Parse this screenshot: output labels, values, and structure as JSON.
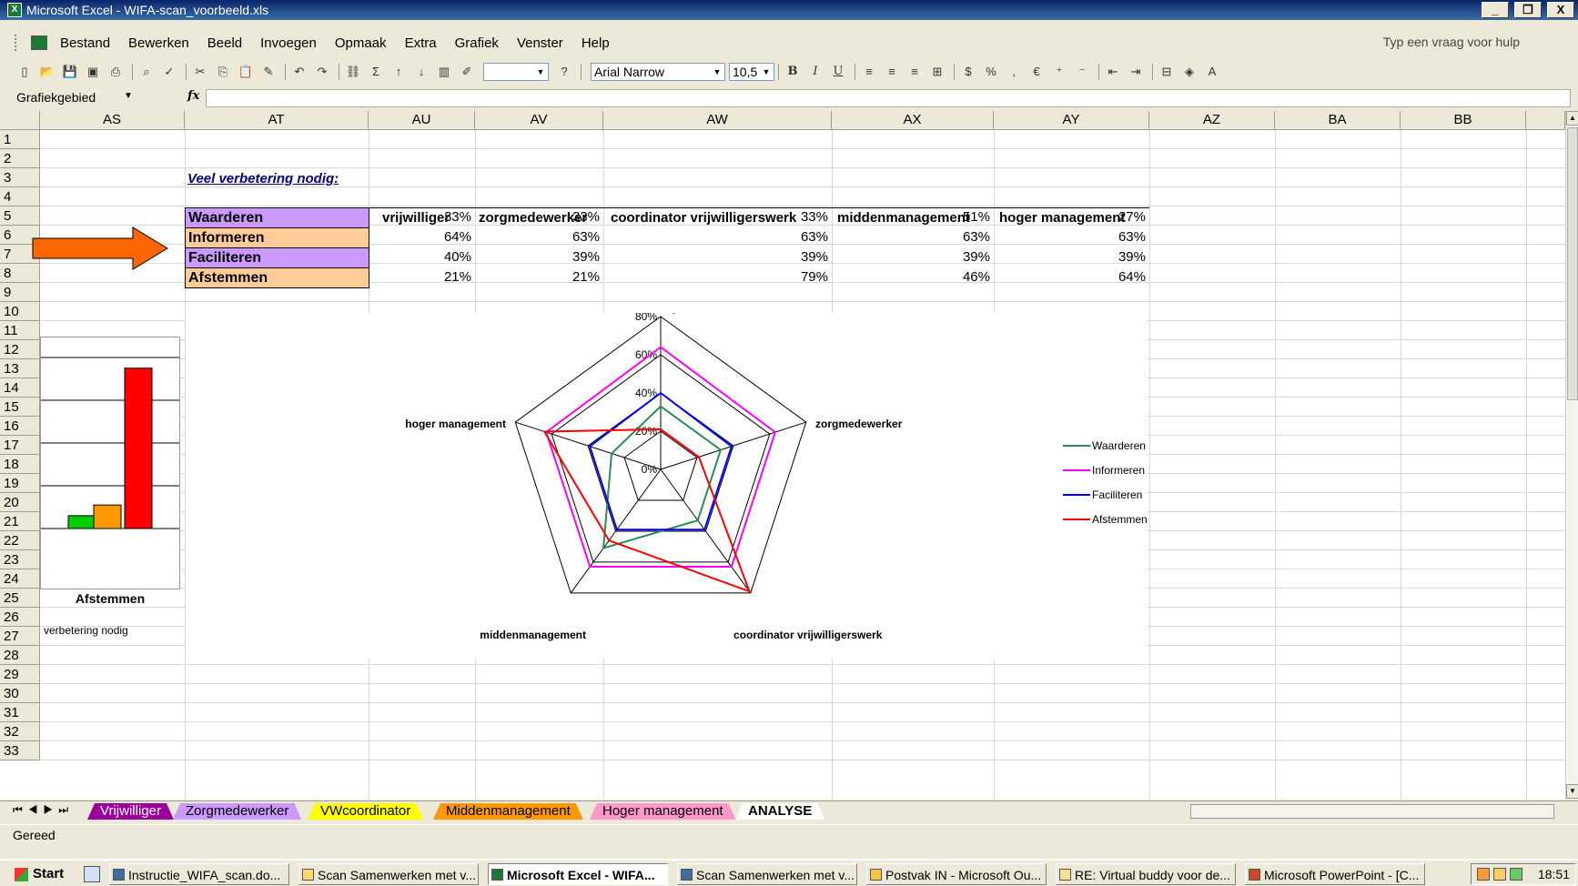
{
  "window": {
    "title": "Microsoft Excel - WIFA-scan_voorbeeld.xls",
    "min_label": "_",
    "restore_label": "❐",
    "close_label": "X"
  },
  "menu": {
    "items": [
      "Bestand",
      "Bewerken",
      "Beeld",
      "Invoegen",
      "Opmaak",
      "Extra",
      "Grafiek",
      "Venster",
      "Help"
    ],
    "help_placeholder": "Typ een vraag voor hulp"
  },
  "toolbar": {
    "font_name": "Arial Narrow",
    "font_size": "10,5",
    "bold_label": "B",
    "italic_label": "I",
    "underline_label": "U"
  },
  "formula_bar": {
    "name_box": "Grafiekgebied",
    "fx_label": "fx",
    "value": ""
  },
  "columns": [
    "AS",
    "AT",
    "AU",
    "AV",
    "AW",
    "AX",
    "AY",
    "AZ",
    "BA",
    "BB"
  ],
  "rows": [
    "1",
    "2",
    "3",
    "4",
    "5",
    "6",
    "7",
    "8",
    "9",
    "10",
    "11",
    "12",
    "13",
    "14",
    "15",
    "16",
    "17",
    "18",
    "19",
    "20",
    "21",
    "22",
    "23",
    "24",
    "25",
    "26",
    "27",
    "28",
    "29",
    "30",
    "31",
    "32",
    "33"
  ],
  "sheet": {
    "section_title": "Veel verbetering nodig:",
    "table_headers": [
      "vrijwilliger",
      "zorgmedewerker",
      "coordinator vrijwilligerswerk",
      "middenmanagement",
      "hoger management"
    ],
    "table_rows": [
      {
        "label": "Waarderen",
        "values": [
          "33%",
          "33%",
          "33%",
          "51%",
          "27%"
        ]
      },
      {
        "label": "Informeren",
        "values": [
          "64%",
          "63%",
          "63%",
          "63%",
          "63%"
        ]
      },
      {
        "label": "Faciliteren",
        "values": [
          "40%",
          "39%",
          "39%",
          "39%",
          "39%"
        ]
      },
      {
        "label": "Afstemmen",
        "values": [
          "21%",
          "21%",
          "79%",
          "46%",
          "64%"
        ]
      }
    ],
    "mini_chart_title": "Afstemmen",
    "mini_chart_subtitle": "verbetering nodig"
  },
  "colors": {
    "waarderen": "#2e8b57",
    "informeren": "#ff00ff",
    "faciliteren": "#0000ff",
    "afstemmen": "#ff0000",
    "label_purple": "#cc99ff",
    "label_orange": "#ffcc99",
    "arrow_orange": "#ff6600"
  },
  "chart_data": [
    {
      "type": "radar",
      "axes": [
        "vrijwilliger",
        "zorgmedewerker",
        "coordinator vrijwilligerswerk",
        "middenmanagement",
        "hoger management"
      ],
      "tick_labels": [
        "0%",
        "20%",
        "40%",
        "60%",
        "80%"
      ],
      "rmax": 80,
      "series": [
        {
          "name": "Waarderen",
          "values": [
            33,
            33,
            33,
            51,
            27
          ],
          "color": "#2e8b57"
        },
        {
          "name": "Informeren",
          "values": [
            64,
            63,
            63,
            63,
            63
          ],
          "color": "#ff00ff"
        },
        {
          "name": "Faciliteren",
          "values": [
            40,
            39,
            39,
            39,
            39
          ],
          "color": "#0000ff"
        },
        {
          "name": "Afstemmen",
          "values": [
            21,
            21,
            79,
            46,
            64
          ],
          "color": "#ff0000"
        }
      ],
      "legend": "right"
    },
    {
      "type": "bar",
      "title": "Afstemmen",
      "xlabel": "verbetering nodig",
      "values": [
        6,
        11,
        75
      ],
      "colors": [
        "#00cc00",
        "#ff9900",
        "#ff0000"
      ],
      "ylim": [
        0,
        80
      ]
    }
  ],
  "sheet_tabs": [
    {
      "label": "Vrijwilliger",
      "color": "#990099",
      "text": "#ffffff"
    },
    {
      "label": "Zorgmedewerker",
      "color": "#cc99ff",
      "text": "#000000"
    },
    {
      "label": "VWcoordinator",
      "color": "#ffff00",
      "text": "#000000"
    },
    {
      "label": "Middenmanagement",
      "color": "#ff9900",
      "text": "#000000"
    },
    {
      "label": "Hoger management",
      "color": "#ff99cc",
      "text": "#000000"
    },
    {
      "label": "ANALYSE",
      "color": "#ffffff",
      "text": "#000000"
    }
  ],
  "status": {
    "text": "Gereed"
  },
  "taskbar": {
    "start_label": "Start",
    "tasks": [
      "Instructie_WIFA_scan.do...",
      "Scan Samenwerken met v...",
      "Microsoft Excel - WIFA...",
      "Scan Samenwerken met v...",
      "Postvak IN - Microsoft Ou...",
      "RE: Virtual buddy voor de...",
      "Microsoft PowerPoint - [C..."
    ],
    "clock": "18:51"
  }
}
